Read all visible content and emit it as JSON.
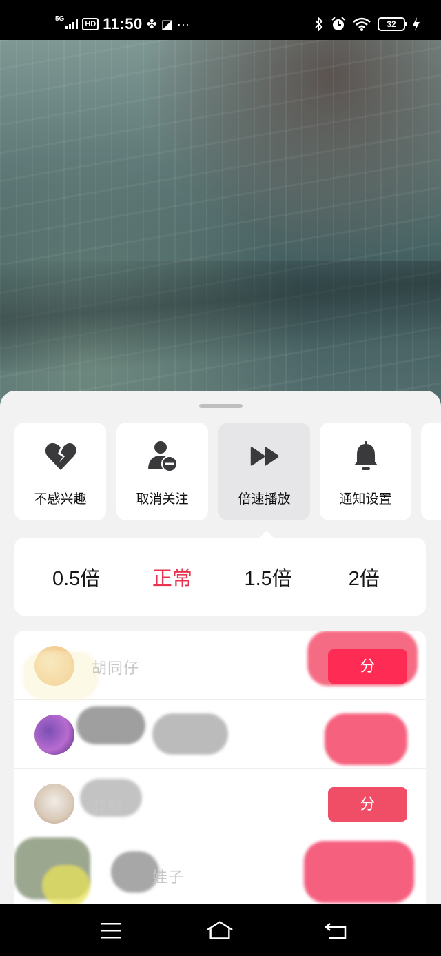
{
  "status_bar": {
    "network": "5G",
    "hd": "HD",
    "time": "11:50",
    "more": "···",
    "battery": "32"
  },
  "sheet": {
    "actions": [
      {
        "label": "不感兴趣",
        "icon": "broken-heart-icon"
      },
      {
        "label": "取消关注",
        "icon": "unfollow-user-icon"
      },
      {
        "label": "倍速播放",
        "icon": "fast-forward-icon"
      },
      {
        "label": "通知设置",
        "icon": "bell-icon"
      }
    ],
    "speed_options": [
      "0.5倍",
      "正常",
      "1.5倍",
      "2倍"
    ],
    "selected_speed": "正常",
    "accent_color": "#fe2c55",
    "users": [
      {
        "name": "胡同仔",
        "button": "分"
      },
      {
        "name": "",
        "button": ""
      },
      {
        "name": "肺嘛",
        "button": "分"
      },
      {
        "name": "娃子",
        "button": ""
      }
    ]
  },
  "nav_bar": {
    "buttons": [
      "menu-icon",
      "home-icon",
      "back-icon"
    ]
  }
}
